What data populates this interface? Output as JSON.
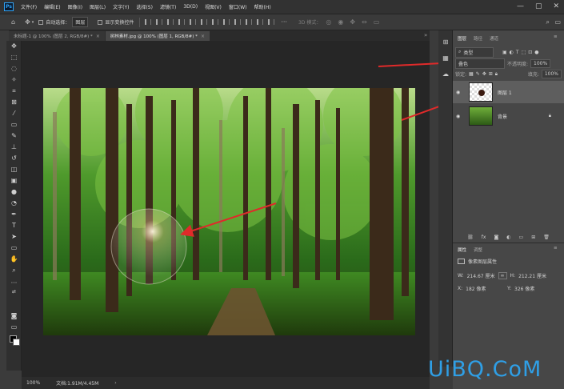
{
  "app": {
    "logo": "Ps"
  },
  "menu": [
    "文件(F)",
    "编辑(E)",
    "图像(I)",
    "图层(L)",
    "文字(Y)",
    "选择(S)",
    "滤镜(T)",
    "3D(D)",
    "视图(V)",
    "窗口(W)",
    "帮助(H)"
  ],
  "window_controls": {
    "minimize": "—",
    "maximize": "▢",
    "close": "✕"
  },
  "options": {
    "auto_select_label": "自动选择：",
    "auto_select_value": "图层",
    "show_transform_label": "显示变换控件",
    "mode_label": "3D 模式："
  },
  "tabs": [
    {
      "label": "未标题-1 @ 100% (图层 2, RGB/8#) *",
      "active": false
    },
    {
      "label": "树林素材.jpg @ 100% (图层 1, RGB/8#) *",
      "active": true
    }
  ],
  "status": {
    "zoom": "100%",
    "doc_info": "文档:1.91M/4.45M"
  },
  "layers_panel": {
    "tabs": [
      "图层",
      "路径",
      "通道"
    ],
    "filter_label": "类型",
    "blend_mode": "叠色",
    "opacity_label": "不透明度:",
    "opacity_value": "100%",
    "lock_label": "锁定:",
    "fill_label": "填充:",
    "fill_value": "100%",
    "layers": [
      {
        "name": "图层 1",
        "selected": true
      },
      {
        "name": "背景",
        "selected": false
      }
    ]
  },
  "properties_panel": {
    "tabs": [
      "属性",
      "调整"
    ],
    "section_title": "像素图层属性",
    "w_label": "W:",
    "w_value": "214.67 厘米",
    "h_label": "H:",
    "h_value": "212.21 厘米",
    "x_label": "X:",
    "x_value": "182 像素",
    "y_label": "Y:",
    "y_value": "326 像素"
  },
  "watermark": "UiBQ.CoM",
  "colors": {
    "accent": "#2fa3f6",
    "arrow": "#e02a2a",
    "watermark": "#2f9fe6"
  }
}
